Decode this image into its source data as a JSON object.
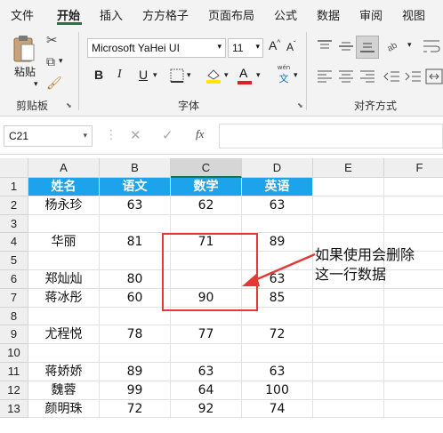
{
  "tabs": [
    "文件",
    "开始",
    "插入",
    "方方格子",
    "页面布局",
    "公式",
    "数据",
    "审阅",
    "视图"
  ],
  "active_tab": "开始",
  "ribbon": {
    "paste_label": "粘贴",
    "clipboard_group": "剪贴板",
    "font_group": "字体",
    "align_group": "对齐方式",
    "font_name": "Microsoft YaHei UI",
    "font_size": "11",
    "bold": "B",
    "italic": "I",
    "underline": "U",
    "grow_font": "A",
    "shrink_font": "A",
    "font_color_letter": "A",
    "phonetic": "wén",
    "phonetic_char": "文",
    "accent_color": "#217346"
  },
  "formula_bar": {
    "name_box": "C21",
    "fx": "fx",
    "formula": ""
  },
  "columns": [
    "A",
    "B",
    "C",
    "D",
    "E",
    "F"
  ],
  "selected_column": "C",
  "rows": [
    {
      "num": "1",
      "cells": [
        "姓名",
        "语文",
        "数学",
        "英语",
        "",
        ""
      ],
      "header": true
    },
    {
      "num": "2",
      "cells": [
        "杨永珍",
        "63",
        "62",
        "63",
        "",
        ""
      ]
    },
    {
      "num": "3",
      "cells": [
        "",
        "",
        "",
        "",
        "",
        ""
      ]
    },
    {
      "num": "4",
      "cells": [
        "华丽",
        "81",
        "71",
        "89",
        "",
        ""
      ]
    },
    {
      "num": "5",
      "cells": [
        "",
        "",
        "",
        "",
        "",
        ""
      ]
    },
    {
      "num": "6",
      "cells": [
        "郑灿灿",
        "80",
        "",
        "63",
        "",
        ""
      ]
    },
    {
      "num": "7",
      "cells": [
        "蒋冰彤",
        "60",
        "90",
        "85",
        "",
        ""
      ]
    },
    {
      "num": "8",
      "cells": [
        "",
        "",
        "",
        "",
        "",
        ""
      ]
    },
    {
      "num": "9",
      "cells": [
        "尤程悦",
        "78",
        "77",
        "72",
        "",
        ""
      ]
    },
    {
      "num": "10",
      "cells": [
        "",
        "",
        "",
        "",
        "",
        ""
      ]
    },
    {
      "num": "11",
      "cells": [
        "蒋娇娇",
        "89",
        "63",
        "63",
        "",
        ""
      ]
    },
    {
      "num": "12",
      "cells": [
        "魏蓉",
        "99",
        "64",
        "100",
        "",
        ""
      ]
    },
    {
      "num": "13",
      "cells": [
        "颜明珠",
        "72",
        "92",
        "74",
        "",
        ""
      ]
    }
  ],
  "annotation": {
    "line1": "如果使用会删除",
    "line2": "这一行数据",
    "color": "#e53935"
  }
}
